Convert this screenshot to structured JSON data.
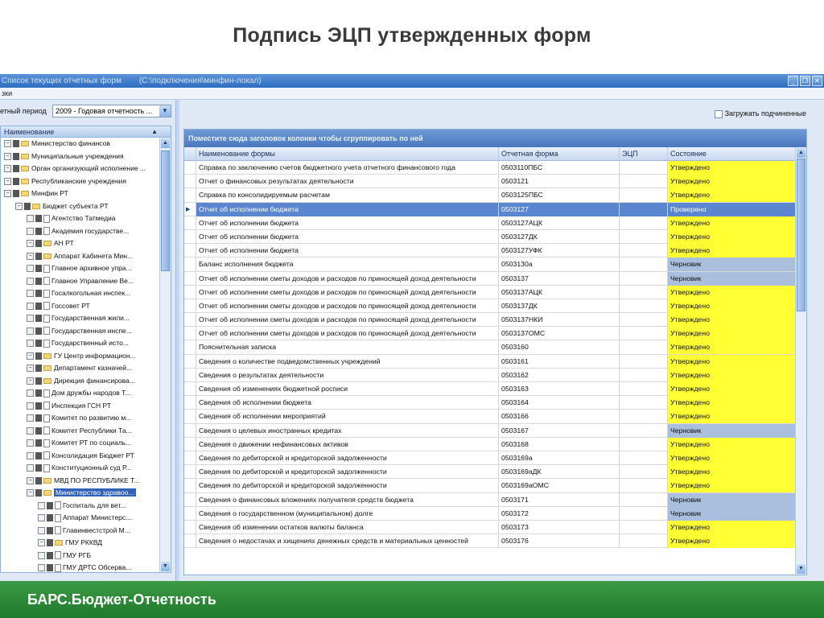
{
  "slide": {
    "title": "Подпись ЭЦП утвержденных форм",
    "footer": "БАРС.Бюджет-Отчетность"
  },
  "window": {
    "title": "Список текущих отчетных форм",
    "path": "(C:\\подключения\\минфин-локал)",
    "menu": "зки"
  },
  "left": {
    "period_label": "етный период",
    "period_value": "2009 - Годовая отчетность ...",
    "tree_header": "Наименование",
    "tree": [
      {
        "level": 0,
        "label": "Министерство финансов",
        "icon": "folder"
      },
      {
        "level": 0,
        "label": "Муниципальные учреждения",
        "icon": "folder"
      },
      {
        "level": 0,
        "label": "Орган организующий исполнение ...",
        "icon": "folder"
      },
      {
        "level": 0,
        "label": "Республиканские учреждения",
        "icon": "folder"
      },
      {
        "level": 1,
        "label": "Минфин РТ",
        "icon": "folder"
      },
      {
        "level": 2,
        "label": "Бюджет субъекта РТ",
        "icon": "folder"
      },
      {
        "level": 3,
        "label": "Агентство  Татмедиа",
        "icon": "doc"
      },
      {
        "level": 3,
        "label": "Академия государстве...",
        "icon": "doc"
      },
      {
        "level": 3,
        "label": "АН РТ",
        "icon": "folder"
      },
      {
        "level": 3,
        "label": "Аппарат Кабинета Мин...",
        "icon": "folder"
      },
      {
        "level": 3,
        "label": "Главное архивное упра...",
        "icon": "doc"
      },
      {
        "level": 3,
        "label": "Главное Управление Ве...",
        "icon": "doc"
      },
      {
        "level": 3,
        "label": "Госалкогольная инспек...",
        "icon": "doc"
      },
      {
        "level": 3,
        "label": "Госсовет РТ",
        "icon": "doc"
      },
      {
        "level": 3,
        "label": "Государственная жили...",
        "icon": "doc"
      },
      {
        "level": 3,
        "label": "Государственная инспе...",
        "icon": "doc"
      },
      {
        "level": 3,
        "label": "Государственный исто...",
        "icon": "doc"
      },
      {
        "level": 3,
        "label": "ГУ  Центр информацион...",
        "icon": "folder"
      },
      {
        "level": 3,
        "label": "Департамент казначей...",
        "icon": "folder"
      },
      {
        "level": 3,
        "label": "Дирекция финансирова...",
        "icon": "folder"
      },
      {
        "level": 3,
        "label": "Дом дружбы народов Т...",
        "icon": "doc"
      },
      {
        "level": 3,
        "label": "Инспекция ГСН РТ",
        "icon": "doc"
      },
      {
        "level": 3,
        "label": "Комитет по развитию м...",
        "icon": "doc"
      },
      {
        "level": 3,
        "label": "Комитет Республики Та...",
        "icon": "doc"
      },
      {
        "level": 3,
        "label": "Комитет РТ по социаль...",
        "icon": "doc"
      },
      {
        "level": 3,
        "label": "Консолидация Бюджет РТ",
        "icon": "doc"
      },
      {
        "level": 3,
        "label": "Конституционный суд Р...",
        "icon": "doc"
      },
      {
        "level": 3,
        "label": "МВД ПО РЕСПУБЛИКЕ Т...",
        "icon": "folder"
      },
      {
        "level": 3,
        "label": "Министерство здравоо...",
        "icon": "folder",
        "selected": true
      },
      {
        "level": 4,
        "label": "Госпиталь для вет...",
        "icon": "doc"
      },
      {
        "level": 4,
        "label": "Аппарат Министерс...",
        "icon": "doc"
      },
      {
        "level": 4,
        "label": "Главинвестстрой М...",
        "icon": "doc"
      },
      {
        "level": 4,
        "label": "ГМУ  РККВД",
        "icon": "folder"
      },
      {
        "level": 4,
        "label": "ГМУ РГБ",
        "icon": "doc"
      },
      {
        "level": 4,
        "label": "ГМУ ДРТС  Обсерва...",
        "icon": "doc"
      }
    ]
  },
  "right": {
    "checkbox_label": "Загружать подчиненные",
    "group_hint": "Поместите сюда заголовок колонки чтобы сгруппировать по ней",
    "columns": [
      "Наименование формы",
      "Отчетная форма",
      "ЭЦП",
      "Состояние"
    ],
    "status_colors": {
      "Утверждено": "#ffff33",
      "Черновик": "#a9bfdd",
      "Проверено": "#5b86cf"
    },
    "rows": [
      {
        "name": "Справка по заключению счетов бюджетного учета отчетного финансового года",
        "form": "0503110ПБС",
        "state": "Утверждено"
      },
      {
        "name": "Отчет о финансовых результатах деятельности",
        "form": "0503121",
        "state": "Утверждено"
      },
      {
        "name": "Справка по консолидируемым расчетам",
        "form": "0503125ПБС",
        "state": "Утверждено"
      },
      {
        "name": "Отчет об исполнении бюджета",
        "form": "0503127",
        "state": "Проверено",
        "current": true
      },
      {
        "name": "Отчет об исполнении бюджета",
        "form": "0503127АЦК",
        "state": "Утверждено"
      },
      {
        "name": "Отчет об исполнении бюджета",
        "form": "0503127ДК",
        "state": "Утверждено"
      },
      {
        "name": "Отчет об исполнении бюджета",
        "form": "0503127УФК",
        "state": "Утверждено"
      },
      {
        "name": "Баланс исполнения бюджета",
        "form": "0503130а",
        "state": "Черновик"
      },
      {
        "name": "Отчет об исполнении сметы доходов и расходов по приносящей доход деятельности",
        "form": "0503137",
        "state": "Черновик"
      },
      {
        "name": "Отчет об исполнении сметы доходов и расходов по приносящей доход деятельности",
        "form": "0503137АЦК",
        "state": "Утверждено"
      },
      {
        "name": "Отчет об исполнении сметы доходов и расходов по приносящей доход деятельности",
        "form": "0503137ДК",
        "state": "Утверждено"
      },
      {
        "name": "Отчет об исполнении сметы доходов и расходов по приносящей доход деятельности",
        "form": "0503137НКИ",
        "state": "Утверждено"
      },
      {
        "name": "Отчет об исполнении сметы доходов и расходов по приносящей доход деятельности",
        "form": "0503137ОМС",
        "state": "Утверждено"
      },
      {
        "name": "Пояснительная записка",
        "form": "0503160",
        "state": "Утверждено"
      },
      {
        "name": "Сведения о количестве подведомственных учреждений",
        "form": "0503161",
        "state": "Утверждено"
      },
      {
        "name": "Сведения о результатах деятельности",
        "form": "0503162",
        "state": "Утверждено"
      },
      {
        "name": "Сведения об изменениях бюджетной росписи",
        "form": "0503163",
        "state": "Утверждено"
      },
      {
        "name": "Сведения об исполнении бюджета",
        "form": "0503164",
        "state": "Утверждено"
      },
      {
        "name": "Сведения об исполнении мероприятий",
        "form": "0503166",
        "state": "Утверждено"
      },
      {
        "name": "Сведения о целевых иностранных кредитах",
        "form": "0503167",
        "state": "Черновик"
      },
      {
        "name": "Сведения о движении нефинансовых активов",
        "form": "0503168",
        "state": "Утверждено"
      },
      {
        "name": "Сведения по дебиторской и кредиторской задолженности",
        "form": "0503169а",
        "state": "Утверждено"
      },
      {
        "name": "Сведения по дебиторской и кредиторской задолженности",
        "form": "0503169аДК",
        "state": "Утверждено"
      },
      {
        "name": "Сведения по дебиторской и кредиторской задолженности",
        "form": "0503169аОМС",
        "state": "Утверждено"
      },
      {
        "name": "Сведения о финансовых вложениях получателя средств бюджета",
        "form": "0503171",
        "state": "Черновик"
      },
      {
        "name": "Сведения о государственном (муниципальном) долге",
        "form": "0503172",
        "state": "Черновик"
      },
      {
        "name": "Сведения об изменении остатков валюты баланса",
        "form": "0503173",
        "state": "Утверждено"
      },
      {
        "name": "Сведения о недостачах и хищениях денежных средств и материальных ценностей",
        "form": "0503176",
        "state": "Утверждено"
      }
    ]
  }
}
